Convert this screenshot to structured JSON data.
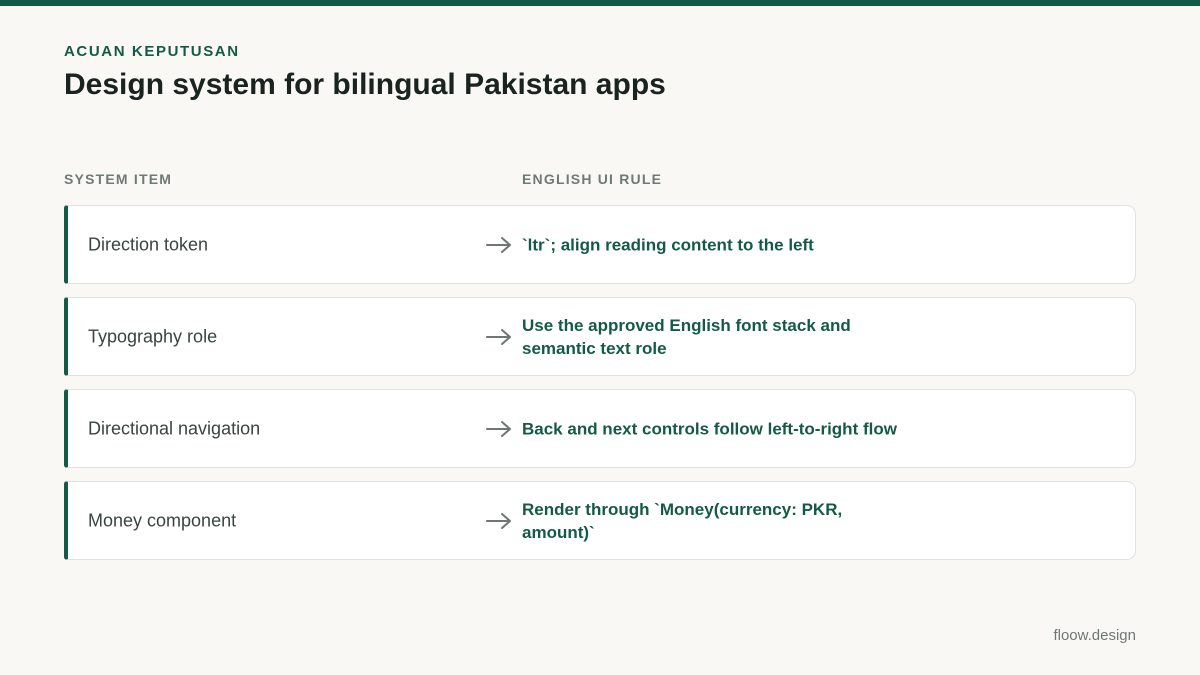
{
  "header": {
    "eyebrow": "ACUAN KEPUTUSAN",
    "title": "Design system for bilingual Pakistan apps"
  },
  "columns": {
    "left": "SYSTEM ITEM",
    "right": "ENGLISH UI RULE"
  },
  "rows": [
    {
      "item": "Direction token",
      "rule": "`ltr`; align reading content to the left"
    },
    {
      "item": "Typography role",
      "rule": "Use the approved English font stack and semantic text role"
    },
    {
      "item": "Directional navigation",
      "rule": "Back and next controls follow left-to-right flow"
    },
    {
      "item": "Money component",
      "rule": "Render through `Money(currency: PKR, amount)`"
    }
  ],
  "footer": {
    "brand": "floow.design"
  },
  "colors": {
    "accent": "#145a46",
    "background": "#f9f8f5",
    "muted": "#707a75"
  },
  "icons": {
    "row_arrow": "arrow-right-icon"
  }
}
